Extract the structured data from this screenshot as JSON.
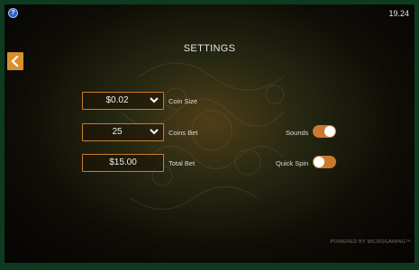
{
  "status": {
    "time": "19.24"
  },
  "header": {
    "title": "SETTINGS"
  },
  "settings": {
    "coin_size": {
      "value": "$0.02",
      "label": "Coin Size"
    },
    "coins_bet": {
      "value": "25",
      "label": "Coins Bet"
    },
    "total_bet": {
      "value": "$15.00",
      "label": "Total Bet"
    },
    "sounds": {
      "label": "Sounds",
      "on": true
    },
    "quick_spin": {
      "label": "Quick Spin",
      "on": false
    }
  },
  "footer": {
    "text": "POWERED BY MICROGAMING™"
  },
  "colors": {
    "accent": "#c97a2f",
    "frame": "#0e3b1f",
    "help": "#2f63c8"
  },
  "icons": {
    "help": "help-icon",
    "back": "chevron-left-icon",
    "dropdown": "chevron-down-icon"
  }
}
